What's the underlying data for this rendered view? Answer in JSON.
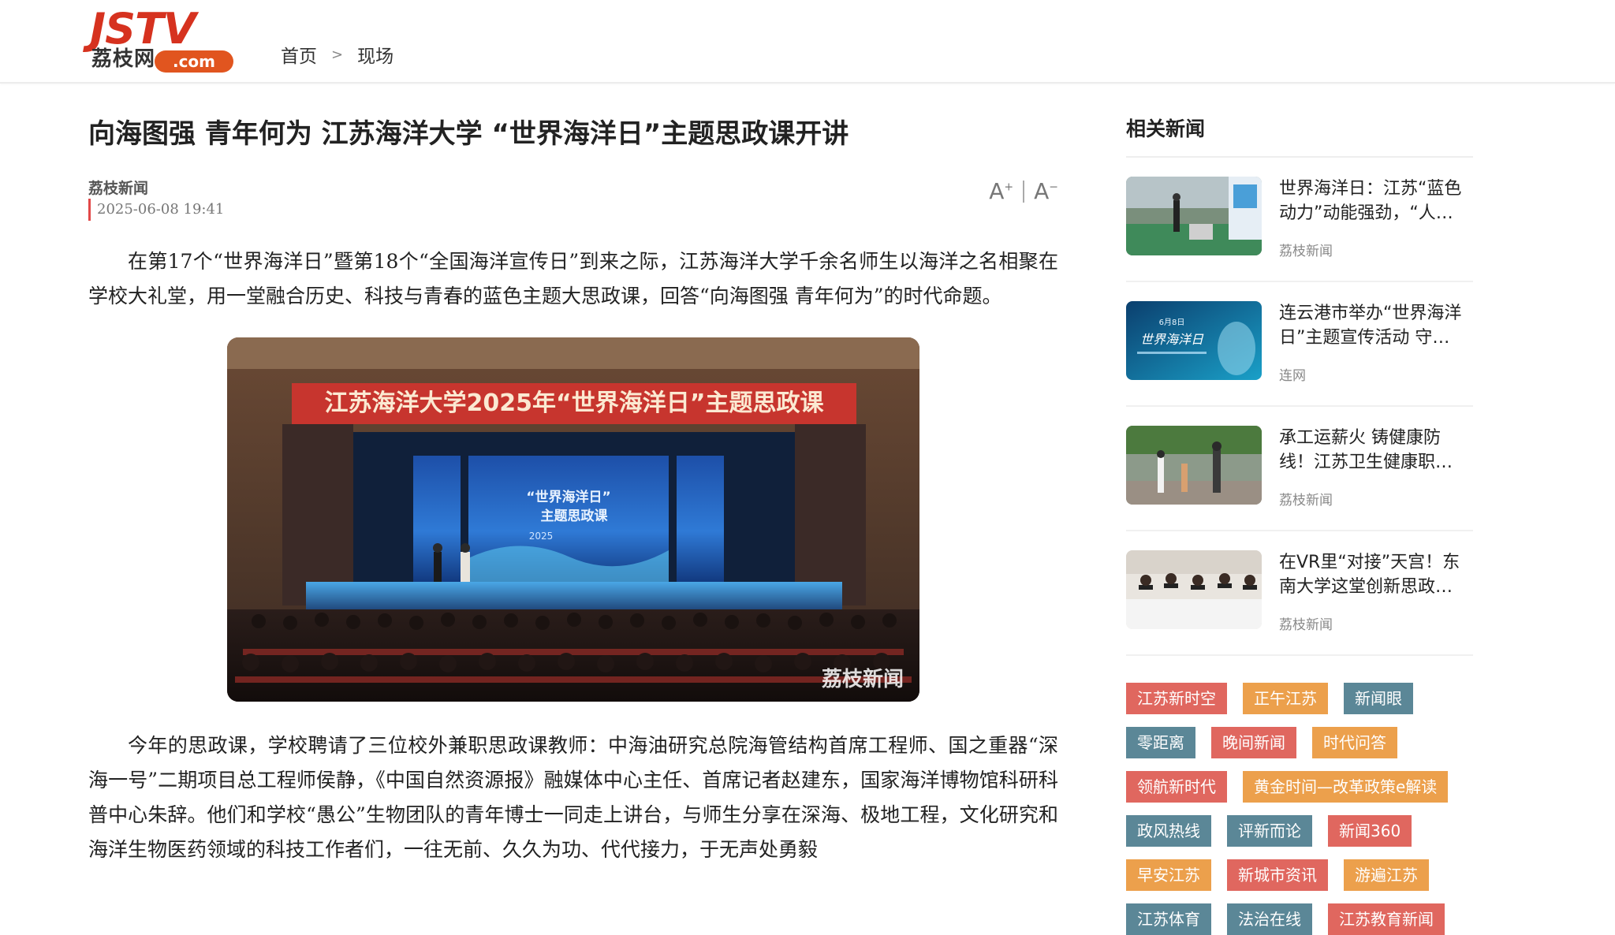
{
  "header": {
    "logo_jstv": "JSTV",
    "logo_cn": "荔枝网",
    "logo_com": ".com",
    "breadcrumb": {
      "home": "首页",
      "sep": ">",
      "section": "现场"
    }
  },
  "article": {
    "title": "向海图强 青年何为 江苏海洋大学 “世界海洋日”主题思政课开讲",
    "source": "荔枝新闻",
    "date": "2025-06-08 19:41",
    "font_increase": "A",
    "font_increase_sup": "+",
    "font_decrease": "A",
    "font_decrease_sup": "−",
    "paragraph1": "在第17个“世界海洋日”暨第18个“全国海洋宣传日”到来之际，江苏海洋大学千余名师生以海洋之名相聚在学校大礼堂，用一堂融合历史、科技与青春的蓝色主题大思政课，回答“向海图强 青年何为”的时代命题。",
    "image": {
      "banner_text": "江苏海洋大学2025年“世界海洋日”主题思政课",
      "screen_line1": "“世界海洋日”",
      "screen_line2": "主题思政课",
      "screen_year": "2025",
      "watermark": "荔枝新闻"
    },
    "paragraph2": "今年的思政课，学校聘请了三位校外兼职思政课教师：中海油研究总院海管结构首席工程师、国之重器“深海一号”二期项目总工程师侯静，《中国自然资源报》融媒体中心主任、首席记者赵建东，国家海洋博物馆科研科普中心朱辞。他们和学校“愚公”生物团队的青年博士一同走上讲台，与师生分享在深海、极地工程，文化研究和海洋生物医药领域的科技工作者们，一往无前、久久为功、代代接力，于无声处勇毅"
  },
  "sidebar": {
    "title": "相关新闻",
    "items": [
      {
        "title": "世界海洋日：江苏“蓝色动力”动能强劲，“人…",
        "source": "荔枝新闻"
      },
      {
        "title": "连云港市举办“世界海洋日”主题宣传活动 守…",
        "source": "连网",
        "thumb_text": "世界海洋日",
        "thumb_date": "6月8日"
      },
      {
        "title": "承工运薪火 铸健康防线！江苏卫生健康职…",
        "source": "荔枝新闻"
      },
      {
        "title": "在VR里“对接”天宫！东南大学这堂创新思政…",
        "source": "荔枝新闻"
      }
    ],
    "tags": [
      {
        "label": "江苏新时空",
        "color": "#e0675f"
      },
      {
        "label": "正午江苏",
        "color": "#eca04c"
      },
      {
        "label": "新闻眼",
        "color": "#5b8797"
      },
      {
        "label": "零距离",
        "color": "#5b8797"
      },
      {
        "label": "晚间新闻",
        "color": "#e0675f"
      },
      {
        "label": "时代问答",
        "color": "#eca04c"
      },
      {
        "label": "领航新时代",
        "color": "#e0675f"
      },
      {
        "label": "黄金时间—改革政策e解读",
        "color": "#eca04c"
      },
      {
        "label": "政风热线",
        "color": "#5b8797"
      },
      {
        "label": "评新而论",
        "color": "#5b8797"
      },
      {
        "label": "新闻360",
        "color": "#e0675f"
      },
      {
        "label": "早安江苏",
        "color": "#eca04c"
      },
      {
        "label": "新城市资讯",
        "color": "#e0675f"
      },
      {
        "label": "游遍江苏",
        "color": "#eca04c"
      },
      {
        "label": "江苏体育",
        "color": "#5b8797"
      },
      {
        "label": "法治在线",
        "color": "#5b8797"
      },
      {
        "label": "江苏教育新闻",
        "color": "#e0675f"
      }
    ]
  }
}
